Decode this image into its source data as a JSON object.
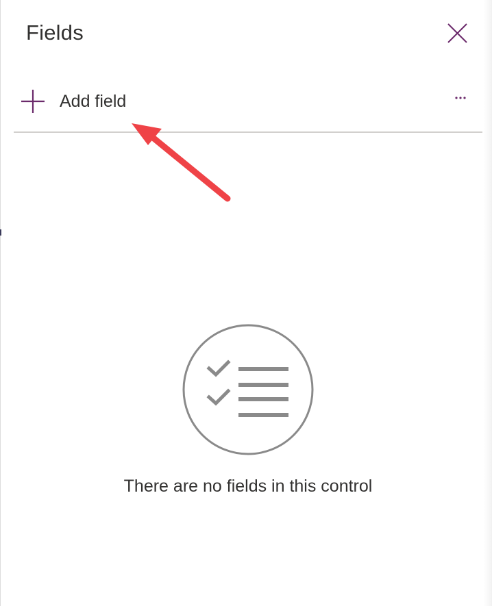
{
  "panel": {
    "title": "Fields",
    "close_icon": "close-icon"
  },
  "toolbar": {
    "add_field_label": "Add field",
    "add_icon": "plus-icon",
    "more_icon": "more-options-icon",
    "more_label": "..."
  },
  "annotation": {
    "arrow_icon": "red-arrow-pointer",
    "arrow_color": "#ef4347"
  },
  "empty_state": {
    "icon": "checklist-icon",
    "message": "There are no fields in this control"
  },
  "colors": {
    "accent": "#6b2a6b",
    "text": "#323130",
    "divider": "#d2d0ce",
    "icon_gray": "#8a8a8a"
  }
}
